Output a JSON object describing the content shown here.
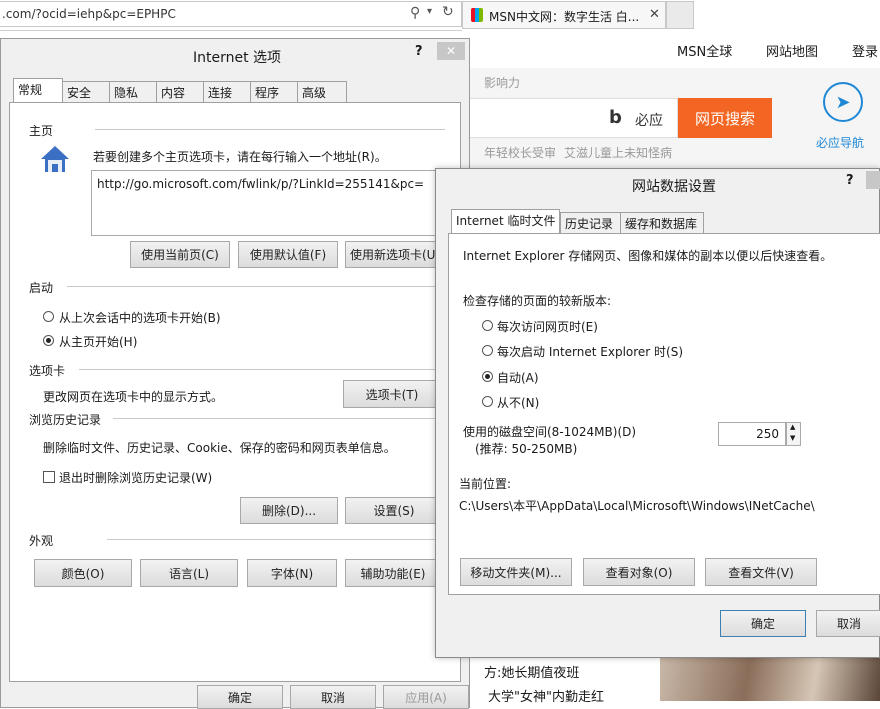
{
  "browser": {
    "address_text": ".com/?ocid=iehp&pc=EPHPC",
    "tab_title": "MSN中文网：数字生活 白..."
  },
  "msn": {
    "nav": [
      "MSN全球",
      "网站地图",
      "登录"
    ],
    "influence": "影响力",
    "search_brand": "必应",
    "search_button": "网页搜索",
    "nav_guide": "必应导航",
    "hot_links": [
      "年轻校长受审",
      "艾滋儿童上未知怪病"
    ],
    "news": [
      "方:她长期值夜班",
      "大学\"女神\"内勤走红"
    ]
  },
  "internet_options": {
    "title": "Internet 选项",
    "help_glyph": "?",
    "tabs": [
      "常规",
      "安全",
      "隐私",
      "内容",
      "连接",
      "程序",
      "高级"
    ],
    "homepage": {
      "heading": "主页",
      "desc": "若要创建多个主页选项卡，请在每行输入一个地址(R)。",
      "url": "http://go.microsoft.com/fwlink/p/?LinkId=255141&pc=",
      "buttons": [
        "使用当前页(C)",
        "使用默认值(F)",
        "使用新选项卡(U)"
      ]
    },
    "startup": {
      "heading": "启动",
      "options": [
        {
          "label": "从上次会话中的选项卡开始(B)",
          "selected": false
        },
        {
          "label": "从主页开始(H)",
          "selected": true
        }
      ]
    },
    "tabs_section": {
      "heading": "选项卡",
      "desc": "更改网页在选项卡中的显示方式。",
      "button": "选项卡(T)"
    },
    "history": {
      "heading": "浏览历史记录",
      "desc": "删除临时文件、历史记录、Cookie、保存的密码和网页表单信息。",
      "checkbox_label": "退出时删除浏览历史记录(W)",
      "checkbox_checked": false,
      "delete_button": "删除(D)...",
      "settings_button": "设置(S)"
    },
    "appearance": {
      "heading": "外观",
      "buttons": [
        "颜色(O)",
        "语言(L)",
        "字体(N)",
        "辅助功能(E)"
      ]
    },
    "footer_buttons": [
      "确定",
      "取消",
      "应用(A)"
    ]
  },
  "website_data": {
    "title": "网站数据设置",
    "help_glyph": "?",
    "tabs": [
      "Internet 临时文件",
      "历史记录",
      "缓存和数据库"
    ],
    "intro": "Internet Explorer 存储网页、图像和媒体的副本以便以后快速查看。",
    "check_heading": "检查存储的页面的较新版本:",
    "check_options": [
      {
        "label": "每次访问网页时(E)",
        "selected": false
      },
      {
        "label": "每次启动 Internet Explorer 时(S)",
        "selected": false
      },
      {
        "label": "自动(A)",
        "selected": true
      },
      {
        "label": "从不(N)",
        "selected": false
      }
    ],
    "disk_label": "使用的磁盘空间(8-1024MB)(D)",
    "disk_hint": "(推荐: 50-250MB)",
    "disk_value": "250",
    "location_label": "当前位置:",
    "location_path": "C:\\Users\\本平\\AppData\\Local\\Microsoft\\Windows\\INetCache\\",
    "action_buttons": [
      "移动文件夹(M)...",
      "查看对象(O)",
      "查看文件(V)"
    ],
    "ok_button": "确定",
    "cancel_button": "取消"
  }
}
